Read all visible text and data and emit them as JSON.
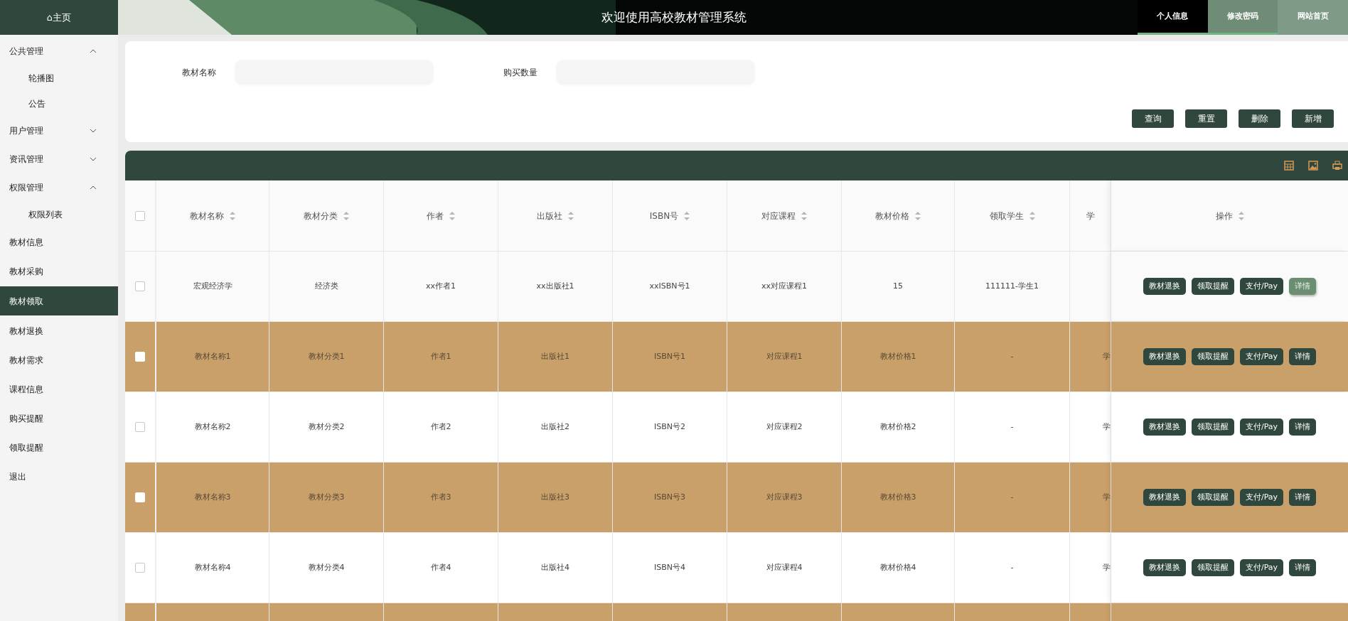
{
  "header": {
    "home": "⌂主页",
    "title": "欢迎使用高校教材管理系统",
    "tabs": [
      {
        "label": "个人信息",
        "selected": true
      },
      {
        "label": "修改密码",
        "selected": false
      },
      {
        "label": "网站首页",
        "selected": false
      }
    ]
  },
  "sidebar": {
    "items": [
      {
        "kind": "group",
        "label": "公共管理",
        "expanded": true,
        "selected": false,
        "children": [
          {
            "label": "轮播图",
            "selected": false
          },
          {
            "label": "公告",
            "selected": false
          }
        ]
      },
      {
        "kind": "group",
        "label": "用户管理",
        "expanded": false,
        "selected": false
      },
      {
        "kind": "group",
        "label": "资讯管理",
        "expanded": false,
        "selected": false
      },
      {
        "kind": "group",
        "label": "权限管理",
        "expanded": true,
        "selected": false,
        "children": [
          {
            "label": "权限列表",
            "selected": false
          }
        ]
      },
      {
        "label": "教材信息",
        "selected": false
      },
      {
        "label": "教材采购",
        "selected": false
      },
      {
        "label": "教材领取",
        "selected": true
      },
      {
        "label": "教材退换",
        "selected": false
      },
      {
        "label": "教材需求",
        "selected": false
      },
      {
        "label": "课程信息",
        "selected": false
      },
      {
        "label": "购买提醒",
        "selected": false
      },
      {
        "label": "领取提醒",
        "selected": false
      },
      {
        "label": "退出",
        "selected": false
      }
    ]
  },
  "search": {
    "fields": [
      {
        "label": "教材名称"
      },
      {
        "label": "购买数量"
      }
    ],
    "buttons": [
      "查询",
      "重置",
      "删除",
      "新增"
    ]
  },
  "table": {
    "select_all_checked": false,
    "columns": [
      "教材名称",
      "教材分类",
      "作者",
      "出版社",
      "ISBN号",
      "对应课程",
      "教材价格",
      "领取学生",
      "学"
    ],
    "action_column": "操作",
    "rows": [
      {
        "shaded": false,
        "checked": false,
        "cells": [
          "宏观经济学",
          "经济类",
          "xx作者1",
          "xx出版社1",
          "xxISBN号1",
          "xx对应课程1",
          "15",
          "111111-学生1"
        ],
        "actions": [
          {
            "label": "教材退换",
            "hovered": false
          },
          {
            "label": "领取提醒",
            "hovered": false
          },
          {
            "label": "支付/Pay",
            "hovered": false
          },
          {
            "label": "详情",
            "hovered": true
          }
        ]
      },
      {
        "shaded": true,
        "checked": false,
        "cells": [
          "教材名称1",
          "教材分类1",
          "作者1",
          "出版社1",
          "ISBN号1",
          "对应课程1",
          "教材价格1",
          "-",
          "学"
        ],
        "actions": [
          {
            "label": "教材退换",
            "hovered": false
          },
          {
            "label": "领取提醒",
            "hovered": false
          },
          {
            "label": "支付/Pay",
            "hovered": false
          },
          {
            "label": "详情",
            "hovered": false
          }
        ]
      },
      {
        "shaded": false,
        "checked": false,
        "cells": [
          "教材名称2",
          "教材分类2",
          "作者2",
          "出版社2",
          "ISBN号2",
          "对应课程2",
          "教材价格2",
          "-",
          "学"
        ],
        "actions": [
          {
            "label": "教材退换",
            "hovered": false
          },
          {
            "label": "领取提醒",
            "hovered": false
          },
          {
            "label": "支付/Pay",
            "hovered": false
          },
          {
            "label": "详情",
            "hovered": false
          }
        ]
      },
      {
        "shaded": true,
        "checked": false,
        "cells": [
          "教材名称3",
          "教材分类3",
          "作者3",
          "出版社3",
          "ISBN号3",
          "对应课程3",
          "教材价格3",
          "-",
          "学"
        ],
        "actions": [
          {
            "label": "教材退换",
            "hovered": false
          },
          {
            "label": "领取提醒",
            "hovered": false
          },
          {
            "label": "支付/Pay",
            "hovered": false
          },
          {
            "label": "详情",
            "hovered": false
          }
        ]
      },
      {
        "shaded": false,
        "checked": false,
        "cells": [
          "教材名称4",
          "教材分类4",
          "作者4",
          "出版社4",
          "ISBN号4",
          "对应课程4",
          "教材价格4",
          "-",
          "学"
        ],
        "actions": [
          {
            "label": "教材退换",
            "hovered": false
          },
          {
            "label": "领取提醒",
            "hovered": false
          },
          {
            "label": "支付/Pay",
            "hovered": false
          },
          {
            "label": "详情",
            "hovered": false
          }
        ]
      },
      {
        "shaded": true
      }
    ]
  }
}
